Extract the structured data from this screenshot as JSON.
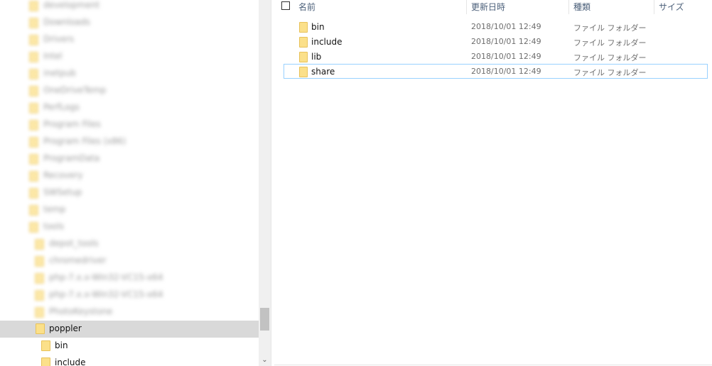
{
  "navigation": {
    "blurred_items": [
      {
        "label": "development",
        "indent": 0
      },
      {
        "label": "Downloads",
        "indent": 0
      },
      {
        "label": "Drivers",
        "indent": 0
      },
      {
        "label": "Intel",
        "indent": 0
      },
      {
        "label": "inetpub",
        "indent": 0
      },
      {
        "label": "OneDriveTemp",
        "indent": 0
      },
      {
        "label": "PerfLogs",
        "indent": 0
      },
      {
        "label": "Program Files",
        "indent": 0
      },
      {
        "label": "Program Files (x86)",
        "indent": 0
      },
      {
        "label": "ProgramData",
        "indent": 0
      },
      {
        "label": "Recovery",
        "indent": 0
      },
      {
        "label": "SWSetup",
        "indent": 0
      },
      {
        "label": "temp",
        "indent": 0
      },
      {
        "label": "tools",
        "indent": 0
      },
      {
        "label": "depot_tools",
        "indent": 1
      },
      {
        "label": "chromedriver",
        "indent": 1
      },
      {
        "label": "php-7.x.x-Win32-VC15-x64",
        "indent": 1
      },
      {
        "label": "php-7.x.x-Win32-VC15-x64",
        "indent": 1
      },
      {
        "label": "PhotoKeystone",
        "indent": 1
      }
    ],
    "items": [
      {
        "label": "poppler",
        "selected": true
      },
      {
        "label": "bin",
        "selected": false
      },
      {
        "label": "include",
        "selected": false
      }
    ],
    "scroll_down_glyph": "⌄"
  },
  "list": {
    "columns": {
      "name": "名前",
      "date": "更新日時",
      "type": "種類",
      "size": "サイズ"
    },
    "rows": [
      {
        "name": "bin",
        "date": "2018/10/01 12:49",
        "type": "ファイル フォルダー",
        "focused": false
      },
      {
        "name": "include",
        "date": "2018/10/01 12:49",
        "type": "ファイル フォルダー",
        "focused": false
      },
      {
        "name": "lib",
        "date": "2018/10/01 12:49",
        "type": "ファイル フォルダー",
        "focused": false
      },
      {
        "name": "share",
        "date": "2018/10/01 12:49",
        "type": "ファイル フォルダー",
        "focused": true
      }
    ]
  },
  "icons": {
    "folder": "folder-icon",
    "checkbox": "checkbox-icon",
    "scroll_down": "chevron-down-icon"
  },
  "colors": {
    "folder_fill": "#fbe08a",
    "selection": "#d9d9d9",
    "focus_border": "#99d1ff",
    "header_text": "#4c607a"
  }
}
